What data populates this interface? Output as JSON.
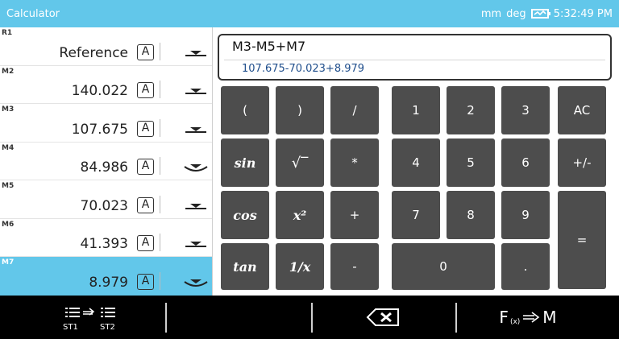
{
  "window": {
    "title": "Calculator",
    "units": "mm",
    "angle_mode": "deg",
    "time": "5:32:49 PM",
    "battery_icon": "battery-charging-icon"
  },
  "list": [
    {
      "id": "R1",
      "value": "Reference",
      "mode": "A",
      "icon": "dropdown-flat-icon",
      "selected": false
    },
    {
      "id": "M2",
      "value": "140.022",
      "mode": "A",
      "icon": "dropdown-flat-icon",
      "selected": false
    },
    {
      "id": "M3",
      "value": "107.675",
      "mode": "A",
      "icon": "dropdown-flat-icon",
      "selected": false
    },
    {
      "id": "M4",
      "value": "84.986",
      "mode": "A",
      "icon": "dropdown-curve-icon",
      "selected": false
    },
    {
      "id": "M5",
      "value": "70.023",
      "mode": "A",
      "icon": "dropdown-flat-icon",
      "selected": false
    },
    {
      "id": "M6",
      "value": "41.393",
      "mode": "A",
      "icon": "dropdown-flat-icon",
      "selected": false
    },
    {
      "id": "M7",
      "value": "8.979",
      "mode": "A",
      "icon": "dropdown-curve-icon",
      "selected": true
    }
  ],
  "display": {
    "expression": "M3-M5+M7",
    "evaluated": "107.675-70.023+8.979"
  },
  "keys": {
    "lparen": "(",
    "rparen": ")",
    "divide": "/",
    "one": "1",
    "two": "2",
    "three": "3",
    "clear": "AC",
    "sin": "sin",
    "sqrt": "√‾",
    "multiply": "*",
    "four": "4",
    "five": "5",
    "six": "6",
    "negate": "+/-",
    "cos": "cos",
    "square": "x²",
    "plus": "+",
    "seven": "7",
    "eight": "8",
    "nine": "9",
    "equals": "=",
    "tan": "tan",
    "reciprocal": "1/x",
    "minus": "-",
    "zero": "0",
    "decimal": "."
  },
  "toolbar": {
    "transfer_from": "ST1",
    "transfer_to": "ST2",
    "backspace_icon": "backspace-icon",
    "fx_label": "F",
    "fx_sub": "(x)",
    "memory_label": "M"
  }
}
